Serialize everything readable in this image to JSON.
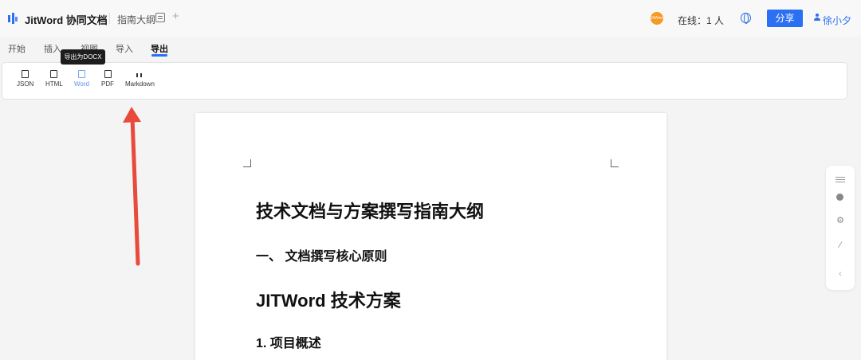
{
  "header": {
    "app_title": "JitWord 协同文档",
    "doc_title": "指南大纲",
    "plus": "+",
    "avatar_text": "JitWord",
    "online": "在线：1 人",
    "share_label": "分享",
    "user_name": "徐小夕"
  },
  "menu_tabs": [
    "开始",
    "插入",
    "视图",
    "导入",
    "导出"
  ],
  "active_tab": "导出",
  "tooltip": "导出为DOCX",
  "toolbar": {
    "buttons": [
      {
        "label": "JSON",
        "icon": "json-file-icon"
      },
      {
        "label": "HTML",
        "icon": "html-file-icon"
      },
      {
        "label": "Word",
        "icon": "word-file-icon"
      },
      {
        "label": "PDF",
        "icon": "pdf-file-icon"
      },
      {
        "label": "Markdown",
        "icon": "markdown-icon"
      }
    ]
  },
  "document": {
    "title": "技术文档与方案撰写指南大纲",
    "section1": "一、 文档撰写核心原则",
    "heading2": "JITWord 技术方案",
    "section2": "1. 项目概述"
  },
  "side_panel": {
    "icons": [
      "menu-icon",
      "history-icon",
      "settings-icon",
      "magic-wand-icon",
      "collapse-icon"
    ],
    "gear": "⚙",
    "wand": "⁄",
    "collapse": "‹"
  },
  "colors": {
    "accent": "#2b6ff3",
    "arrow": "#e84a3c",
    "avatar": "#f59a23"
  }
}
